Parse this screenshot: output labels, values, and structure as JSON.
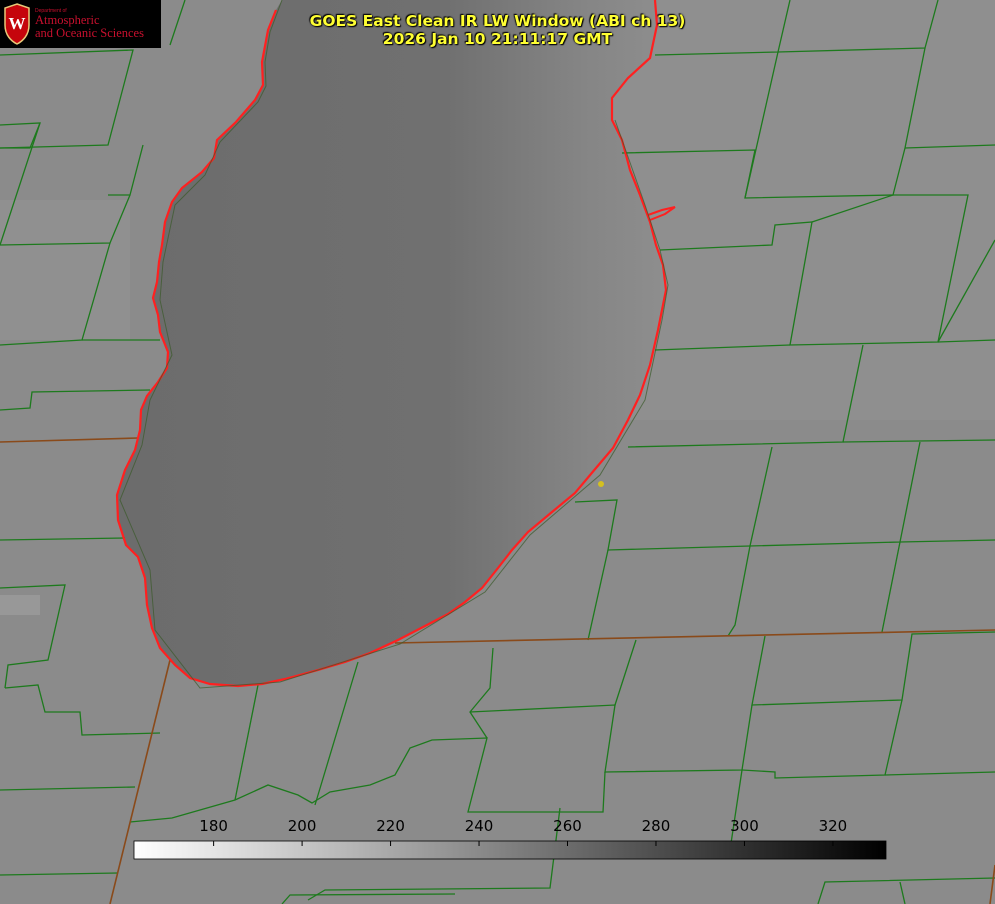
{
  "logo": {
    "department": "Department of",
    "line1": "Atmospheric",
    "line2": "and Oceanic Sciences",
    "crest_letter": "W"
  },
  "header": {
    "title": "GOES East Clean IR LW Window (ABI ch 13)",
    "datetime": "2026 Jan 10 21:11:17 GMT"
  },
  "colorbar": {
    "ticks": [
      "180",
      "200",
      "220",
      "240",
      "260",
      "280",
      "300",
      "320"
    ],
    "range": [
      162,
      332
    ],
    "low_color": "#ffffff",
    "high_color": "#000000"
  },
  "colors": {
    "land": "#8c8c8c",
    "lake": "#6e6e6e",
    "county_lines": "#1a7a1a",
    "state_lines": "#8a4a1a",
    "coastline": "#ff2020",
    "title_text": "#ffff33",
    "marker": "#d4c020"
  }
}
